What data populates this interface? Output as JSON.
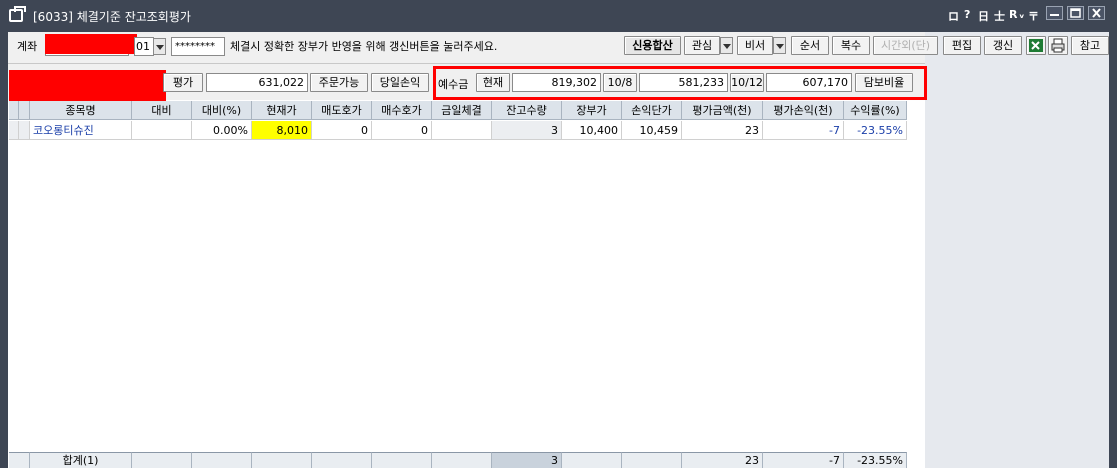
{
  "window": {
    "title": "[6033] 체결기준 잔고조회평가",
    "title_glyphs": [
      "ロ",
      "?",
      "日",
      "士",
      "R",
      "ᵥ",
      "〒"
    ]
  },
  "toolbar": {
    "account_label": "계좌",
    "account_suffix": "01",
    "password_mask": "********",
    "notice": "체결시 정확한 장부가 반영을 위해 갱신버튼을 눌러주세요.",
    "buttons": {
      "credit_total": "신용합산",
      "interest": "관심",
      "secretary": "비서",
      "order": "순서",
      "copy": "복수",
      "after_hours": "시간외(단)",
      "edit": "편집",
      "refresh": "갱신",
      "reference": "참고"
    }
  },
  "summary": {
    "eval_label": "평가",
    "eval_value": "631,022",
    "order_available_btn": "주문가능",
    "daily_pnl_btn": "당일손익",
    "deposit_label": "예수금",
    "current_label": "현재",
    "current_value": "819,302",
    "d1_label": "10/8",
    "d1_value": "581,233",
    "d2_label": "10/12",
    "d2_value": "607,170",
    "collateral_btn": "담보비율"
  },
  "table": {
    "headers": [
      "종목명",
      "대비",
      "대비(%)",
      "현재가",
      "매도호가",
      "매수호가",
      "금일체결",
      "잔고수량",
      "장부가",
      "손익단가",
      "평가금액(천)",
      "평가손익(천)",
      "수익률(%)"
    ],
    "rows": [
      {
        "name": "코오롱티슈진",
        "change": "",
        "change_pct": "0.00%",
        "price": "8,010",
        "ask": "0",
        "bid": "0",
        "today_fill": "",
        "qty": "3",
        "book_price": "10,400",
        "pnl_unit": "10,459",
        "eval_amount": "23",
        "eval_pnl": "-7",
        "return_pct": "-23.55%"
      }
    ],
    "footer": {
      "label": "합계(1)",
      "qty": "3",
      "eval_amount": "23",
      "eval_pnl": "-7",
      "return_pct": "-23.55%"
    }
  },
  "colors": {
    "titlebar": "#3e4654",
    "header_bg": "#dce3ea",
    "price_highlight": "#ffff00",
    "negative_blue": "#1a3ea8",
    "redaction": "#ff0000"
  }
}
